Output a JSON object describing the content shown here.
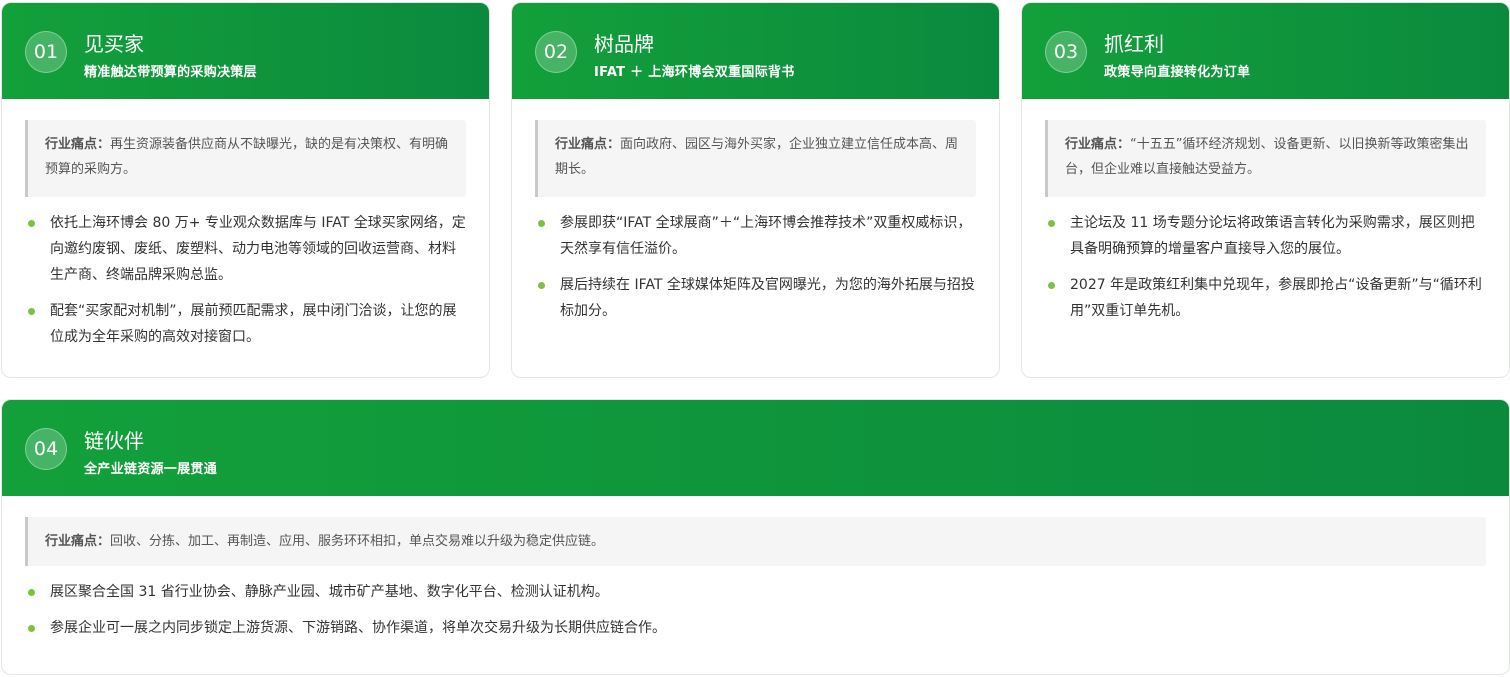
{
  "cards": [
    {
      "number": "01",
      "title": "见买家",
      "subtitle": "精准触达带预算的采购决策层",
      "pain_label": "行业痛点：",
      "pain_text": "再生资源装备供应商从不缺曝光，缺的是有决策权、有明确预算的采购方。",
      "bullets": [
        "依托上海环博会 80 万+ 专业观众数据库与 IFAT 全球买家网络，定向邀约废钢、废纸、废塑料、动力电池等领域的回收运营商、材料生产商、终端品牌采购总监。",
        "配套“买家配对机制”，展前预匹配需求，展中闭门洽谈，让您的展位成为全年采购的高效对接窗口。"
      ]
    },
    {
      "number": "02",
      "title": "树品牌",
      "subtitle": "IFAT ＋ 上海环博会双重国际背书",
      "pain_label": "行业痛点：",
      "pain_text": "面向政府、园区与海外买家，企业独立建立信任成本高、周期长。",
      "bullets": [
        "参展即获“IFAT 全球展商”＋“上海环博会推荐技术”双重权威标识，天然享有信任溢价。",
        "展后持续在 IFAT 全球媒体矩阵及官网曝光，为您的海外拓展与招投标加分。"
      ]
    },
    {
      "number": "03",
      "title": "抓红利",
      "subtitle": "政策导向直接转化为订单",
      "pain_label": "行业痛点：",
      "pain_text": "“十五五”循环经济规划、设备更新、以旧换新等政策密集出台，但企业难以直接触达受益方。",
      "bullets": [
        "主论坛及 11 场专题分论坛将政策语言转化为采购需求，展区则把具备明确预算的增量客户直接导入您的展位。",
        "2027 年是政策红利集中兑现年，参展即抢占“设备更新”与“循环利用”双重订单先机。"
      ]
    },
    {
      "number": "04",
      "title": "链伙伴",
      "subtitle": "全产业链资源一展贯通",
      "pain_label": "行业痛点：",
      "pain_text": "回收、分拣、加工、再制造、应用、服务环环相扣，单点交易难以升级为稳定供应链。",
      "bullets": [
        "展区聚合全国 31 省行业协会、静脉产业园、城市矿产基地、数字化平台、检测认证机构。",
        "参展企业可一展之内同步锁定上游货源、下游销路、协作渠道，将单次交易升级为长期供应链合作。"
      ]
    }
  ],
  "colors": {
    "header_green_start": "#13a03a",
    "header_green_end": "#0b8a3e",
    "bullet_dot": "#7dc143",
    "pain_bg": "#f5f5f5"
  }
}
